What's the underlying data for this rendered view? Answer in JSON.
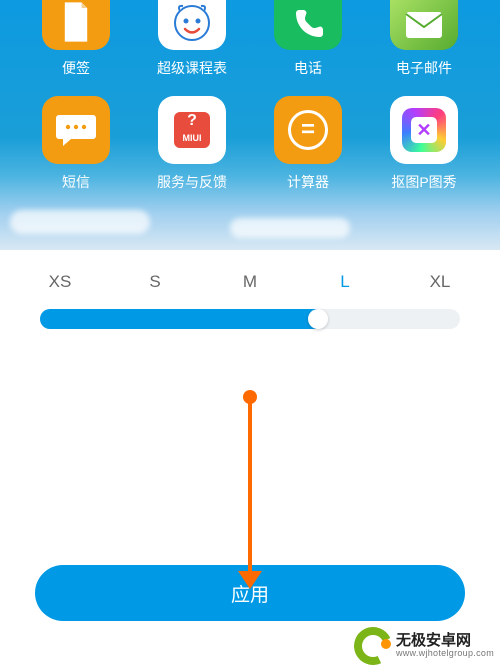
{
  "apps": {
    "row1": [
      {
        "key": "note",
        "label": "便签"
      },
      {
        "key": "course",
        "label": "超级课程表"
      },
      {
        "key": "phone",
        "label": "电话"
      },
      {
        "key": "mail",
        "label": "电子邮件"
      }
    ],
    "row2": [
      {
        "key": "sms",
        "label": "短信"
      },
      {
        "key": "miui",
        "label": "服务与反馈",
        "badge": "MIUI"
      },
      {
        "key": "calc",
        "label": "计算器"
      },
      {
        "key": "pix",
        "label": "抠图P图秀"
      }
    ]
  },
  "sizes": {
    "options": [
      "XS",
      "S",
      "M",
      "L",
      "XL"
    ],
    "selected": "L",
    "fill_percent": 68
  },
  "apply_label": "应用",
  "watermark": {
    "title": "无极安卓网",
    "url": "www.wjhotelgroup.com"
  }
}
